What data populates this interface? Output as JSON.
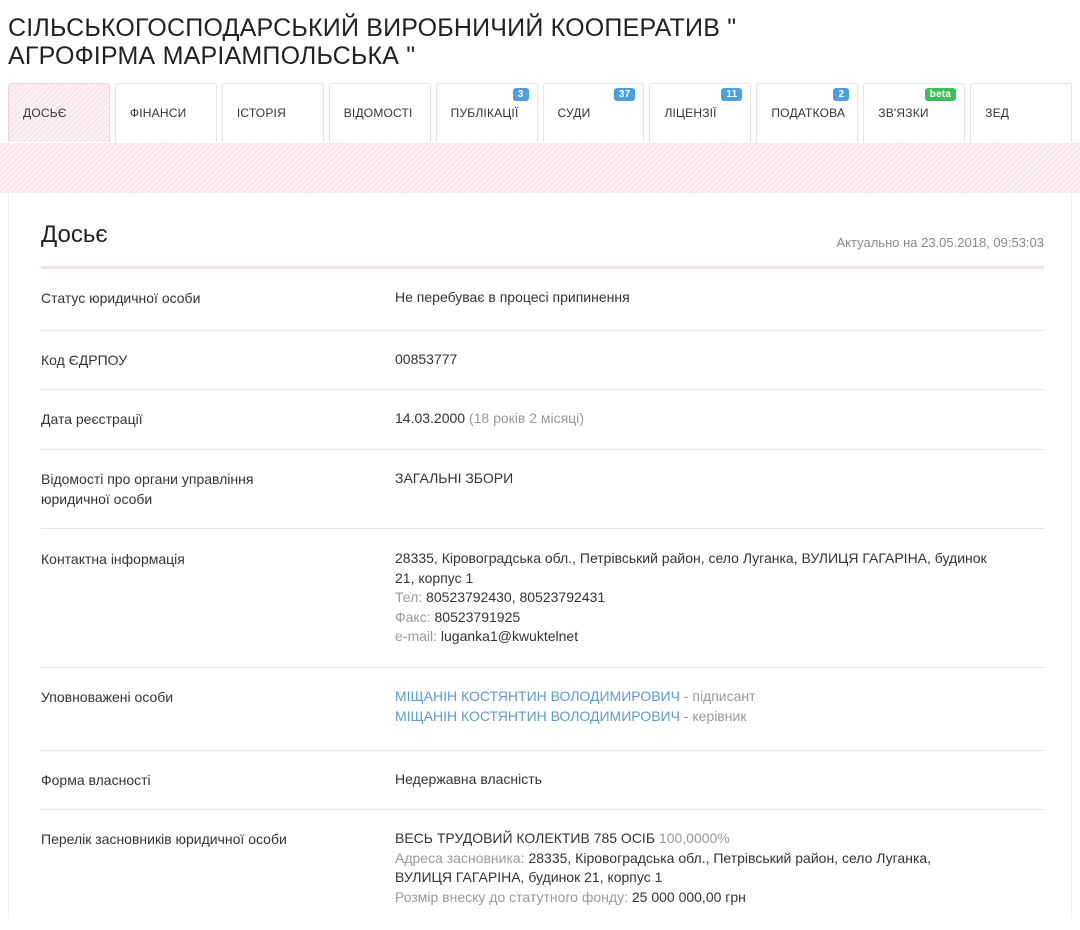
{
  "company": {
    "title_line1": "СІЛЬСЬКОГОСПОДАРСЬКИЙ ВИРОБНИЧИЙ КООПЕРАТИВ \"",
    "title_line2": "АГРОФІРМА МАРІАМПОЛЬСЬКА \""
  },
  "tabs": [
    {
      "label": "ДОСЬЄ",
      "badge": "",
      "active": true
    },
    {
      "label": "ФІНАНСИ",
      "badge": ""
    },
    {
      "label": "ІСТОРІЯ",
      "badge": ""
    },
    {
      "label": "ВІДОМОСТІ",
      "badge": ""
    },
    {
      "label": "ПУБЛІКАЦІЇ",
      "badge": "3"
    },
    {
      "label": "СУДИ",
      "badge": "37"
    },
    {
      "label": "ЛІЦЕНЗІЇ",
      "badge": "11"
    },
    {
      "label": "ПОДАТКОВА",
      "badge": "2"
    },
    {
      "label": "ЗВ'ЯЗКИ",
      "badge": "beta"
    },
    {
      "label": "ЗЕД",
      "badge": ""
    }
  ],
  "colors": {
    "badge_blue": "#4a9fe0",
    "badge_green": "#3cbf5a",
    "status_green": "#4caf50",
    "link_blue": "#5b9bd5"
  },
  "dossier": {
    "title": "Досьє",
    "updated": "Актуально на 23.05.2018, 09:53:03",
    "status": {
      "label": "Статус юридичної особи",
      "value": "Не перебуває в процесі припинення"
    },
    "edrpou": {
      "label": "Код ЄДРПОУ",
      "value": "00853777"
    },
    "registration": {
      "label": "Дата реєстрації",
      "date": "14.03.2000",
      "age": "(18 років 2 місяці)"
    },
    "management": {
      "label_line1": "Відомості про органи управління",
      "label_line2": "юридичної особи",
      "value": "ЗАГАЛЬНІ ЗБОРИ"
    },
    "contacts": {
      "label": "Контактна інформація",
      "address_line1": "28335, Кіровоградська обл., Петрівський район, село Луганка, ВУЛИЦЯ ГАГАРІНА, будинок",
      "address_line2": "21, корпус 1",
      "phone_label": "Тел:",
      "phone": "80523792430, 80523792431",
      "fax_label": "Факс:",
      "fax": "80523791925",
      "email_label": "e-mail:",
      "email": "luganka1@kwuktelnet"
    },
    "authorized": {
      "label": "Уповноважені особи",
      "persons": [
        {
          "name": "МІЩАНІН КОСТЯНТИН ВОЛОДИМИРОВИЧ",
          "role": " - підписант"
        },
        {
          "name": "МІЩАНІН КОСТЯНТИН ВОЛОДИМИРОВИЧ",
          "role": " - керівник"
        }
      ]
    },
    "ownership": {
      "label": "Форма власності",
      "value": "Недержавна власність"
    },
    "founders": {
      "label": "Перелік засновників юридичної особи",
      "name": "ВЕСЬ ТРУДОВИЙ КОЛЕКТИВ 785 ОСІБ",
      "share": "100,0000%",
      "address_label": "Адреса засновника:",
      "address_line1": "28335, Кіровоградська обл., Петрівський район, село Луганка,",
      "address_line2": "ВУЛИЦЯ ГАГАРІНА, будинок 21, корпус 1",
      "contribution_label": "Розмір внеску до статутного фонду:",
      "contribution": "25 000 000,00 грн"
    }
  }
}
